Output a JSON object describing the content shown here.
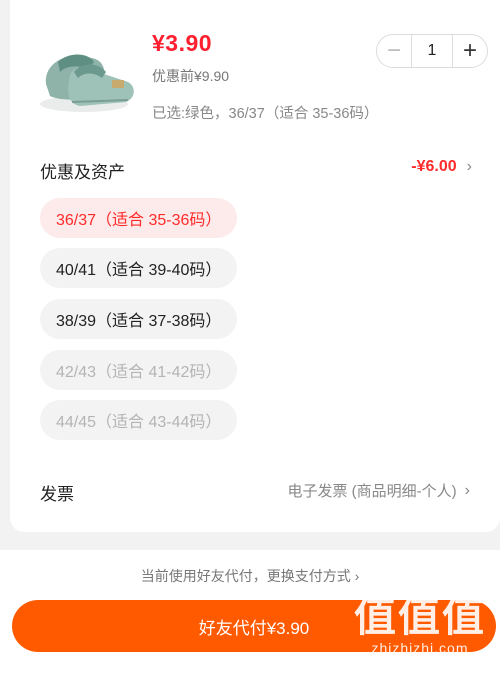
{
  "product": {
    "price": "¥3.90",
    "original_price": "优惠前¥9.90",
    "selected_spec": "已选:绿色，36/37（适合 35-36码）",
    "quantity": "1",
    "image": "slipper-photo"
  },
  "stepper": {
    "minus": "−",
    "plus": "+"
  },
  "discount": {
    "label": "优惠及资产",
    "value": "-¥6.00",
    "chevron": "›"
  },
  "size_options": [
    {
      "label": "36/37（适合 35-36码）",
      "state": "selected"
    },
    {
      "label": "40/41（适合 39-40码）",
      "state": "available"
    },
    {
      "label": "38/39（适合 37-38码）",
      "state": "available"
    },
    {
      "label": "42/43（适合 41-42码）",
      "state": "disabled"
    },
    {
      "label": "44/45（适合 43-44码）",
      "state": "disabled"
    }
  ],
  "invoice": {
    "label": "发票",
    "value": "电子发票 (商品明细-个人)",
    "chevron": "›"
  },
  "payment": {
    "note": "当前使用好友代付，更换支付方式 ›",
    "button": "好友代付¥3.90"
  },
  "watermark": {
    "glyphs": "值值值",
    "text": "zhizhizhi.com"
  },
  "colors": {
    "accent_red": "#ff2b2b",
    "pay_button": "#ff5a00",
    "selected_bg": "#fdeaea"
  }
}
